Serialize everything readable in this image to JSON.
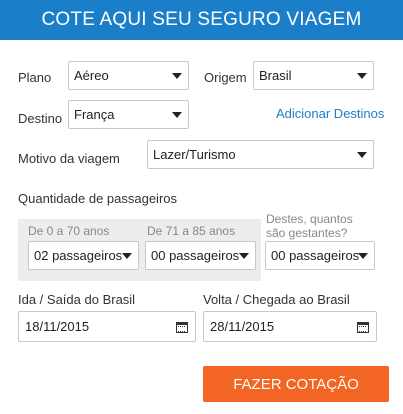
{
  "header": {
    "title": "COTE AQUI SEU SEGURO VIAGEM"
  },
  "form": {
    "plano": {
      "label": "Plano",
      "value": "Aéreo"
    },
    "origem": {
      "label": "Origem",
      "value": "Brasil"
    },
    "destino": {
      "label": "Destino",
      "value": "França"
    },
    "add_destinos": "Adicionar Destinos",
    "motivo": {
      "label": "Motivo da viagem",
      "value": "Lazer/Turismo"
    },
    "passageiros_title": "Quantidade de passageiros",
    "age_0_70": {
      "label": "De 0 a 70 anos",
      "value": "02 passageiros"
    },
    "age_71_85": {
      "label": "De 71 a 85 anos",
      "value": "00 passageiros"
    },
    "gestantes": {
      "label_line1": "Destes, quantos",
      "label_line2": "são gestantes?",
      "value": "00 passageiros"
    },
    "ida": {
      "label": "Ida / Saída do Brasil",
      "value": "18/11/2015"
    },
    "volta": {
      "label": "Volta / Chegada ao Brasil",
      "value": "28/11/2015"
    },
    "submit": "FAZER COTAÇÃO"
  },
  "colors": {
    "header": "#1a7ec8",
    "cta": "#f26522",
    "link": "#1f7fc4"
  }
}
